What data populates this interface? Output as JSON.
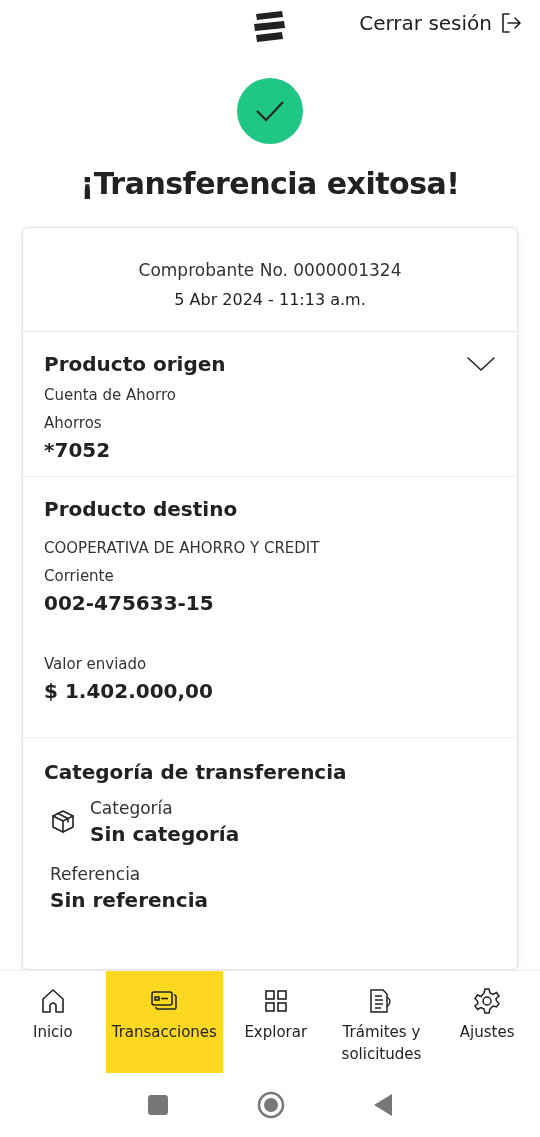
{
  "header": {
    "logout": "Cerrar sesión"
  },
  "title": "¡Transferencia exitosa!",
  "receipt": {
    "number": "Comprobante No. 0000001324",
    "date": "5 Abr 2024 - 11:13 a.m."
  },
  "origin": {
    "heading": "Producto origen",
    "lines": [
      "Cuenta de Ahorro",
      "Ahorros"
    ],
    "account": "*7052"
  },
  "destination": {
    "heading": "Producto destino",
    "lines": [
      "COOPERATIVA DE AHORRO Y CREDIT",
      "Corriente"
    ],
    "account": "002-475633-15",
    "amount_label": "Valor enviado",
    "amount": "$ 1.402.000,00"
  },
  "category": {
    "heading": "Categoría de transferencia",
    "label": "Categoría",
    "value": "Sin categoría",
    "ref_label": "Referencia",
    "ref_value": "Sin referencia"
  },
  "nav": [
    {
      "label": "Inicio",
      "selected": false
    },
    {
      "label": "Transacciones",
      "selected": true
    },
    {
      "label": "Explorar",
      "selected": false
    },
    {
      "label": "Trámites y solicitudes",
      "selected": false
    },
    {
      "label": "Ajustes",
      "selected": false
    }
  ]
}
